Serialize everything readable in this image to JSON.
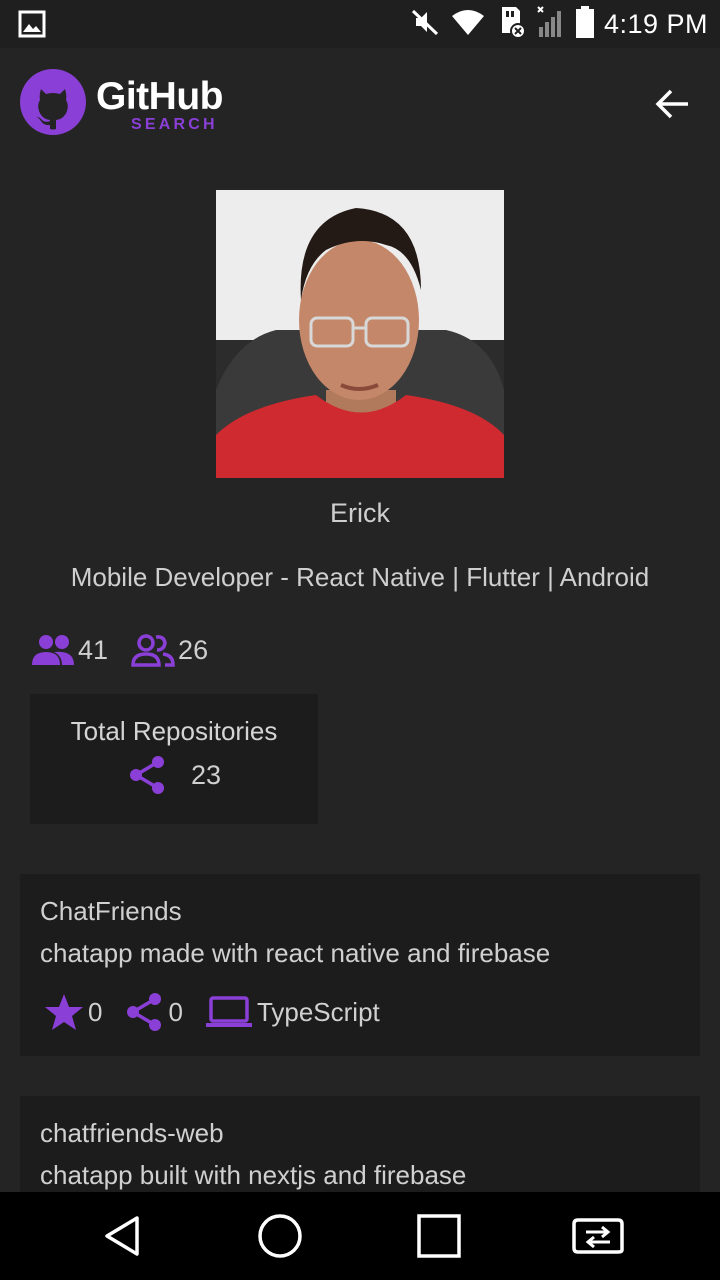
{
  "status_bar": {
    "time": "4:19 PM",
    "icons": [
      "gallery-icon",
      "mute-icon",
      "wifi-icon",
      "sd-card-icon",
      "signal-icon",
      "battery-icon"
    ]
  },
  "header": {
    "logo_title": "GitHub",
    "logo_subtitle": "SEARCH",
    "back_icon": "arrow-left-icon"
  },
  "profile": {
    "name": "Erick",
    "bio": "Mobile Developer - React Native | Flutter | Android",
    "followers": "41",
    "following": "26"
  },
  "repositories": {
    "label": "Total Repositories",
    "count": "23"
  },
  "repo_list": [
    {
      "name": "ChatFriends",
      "description": "chatapp made with react native and firebase",
      "stars": "0",
      "forks": "0",
      "language": "TypeScript"
    },
    {
      "name": "chatfriends-web",
      "description": "chatapp built with nextjs and firebase"
    }
  ],
  "colors": {
    "accent": "#8a3fd6",
    "background": "#242424",
    "card": "#1c1c1c"
  }
}
